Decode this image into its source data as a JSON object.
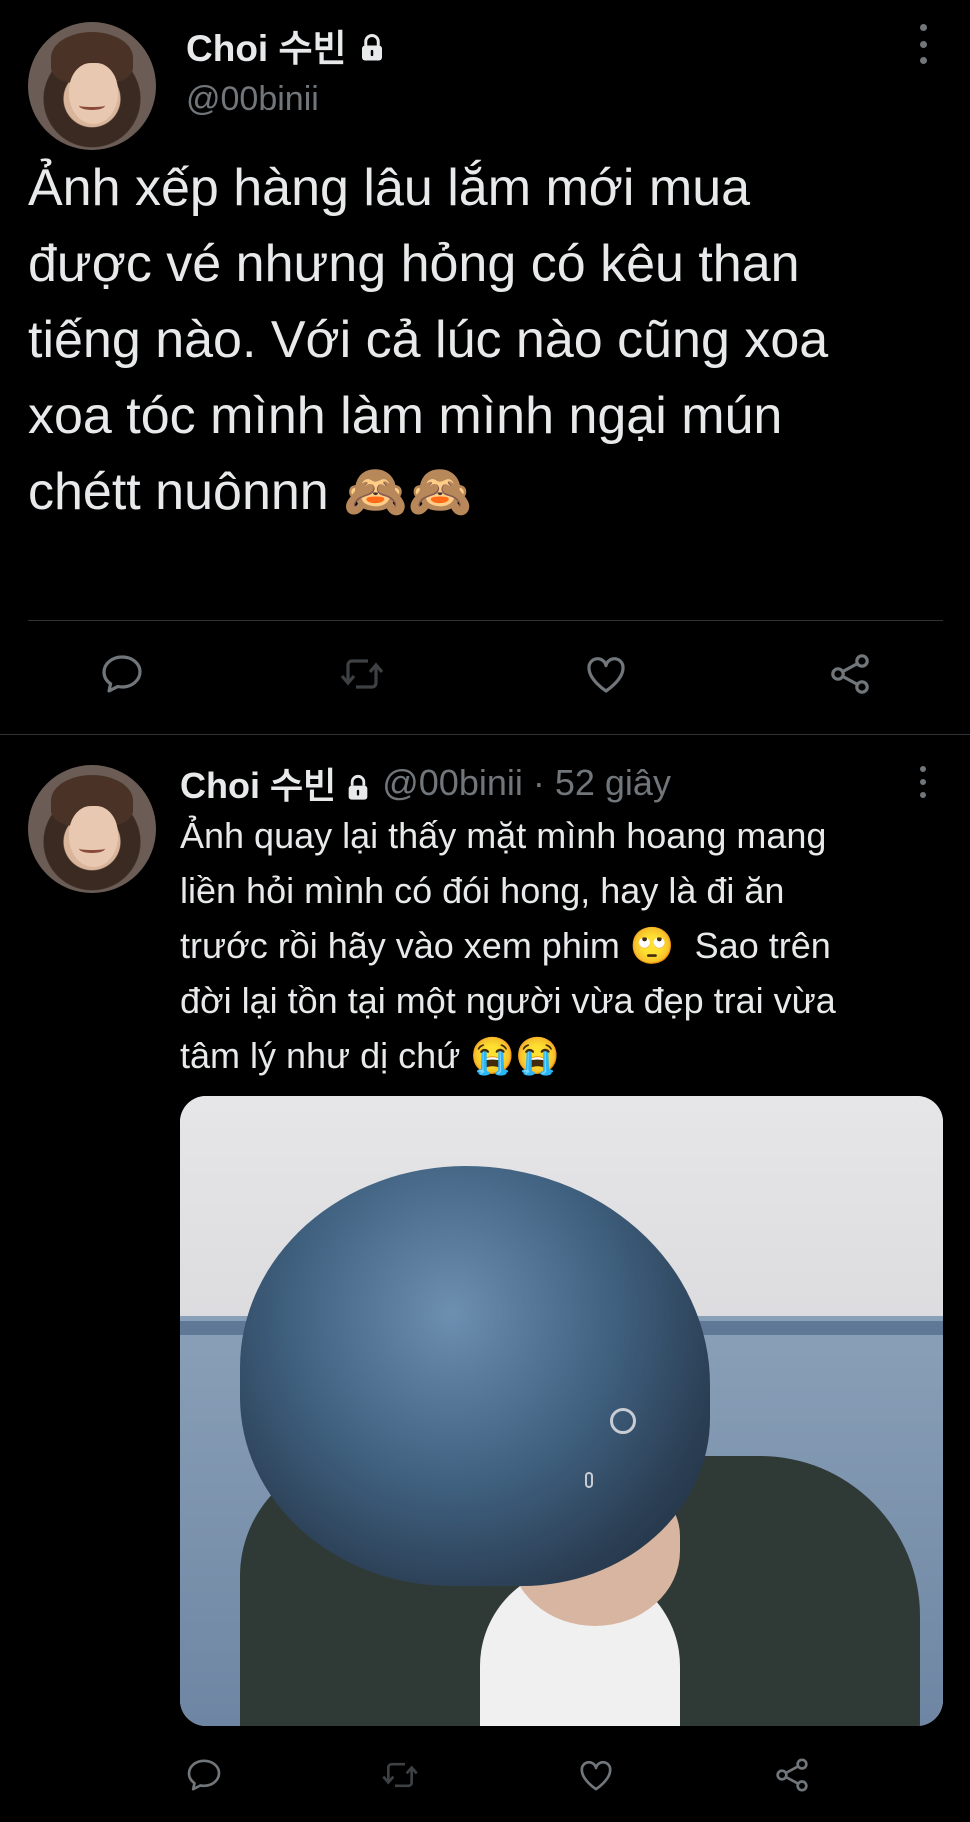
{
  "tweet1": {
    "display_name": "Choi 수빈",
    "handle": "@00binii",
    "text": "Ảnh xếp hàng lâu lắm mới mua\nđược vé nhưng hỏng có kêu than\ntiếng nào. Với cả lúc nào cũng xoa\nxoa tóc mình làm mình ngại mún\nchétt nuônnn 🙈🙈",
    "actions": [
      "reply-icon",
      "retweet-icon",
      "like-icon",
      "share-icon"
    ]
  },
  "tweet2": {
    "display_name": "Choi 수빈",
    "handle": "@00binii",
    "separator": "·",
    "time": "52 giây",
    "text": "Ảnh quay lại thấy mặt mình hoang mang\nliền hỏi mình có đói hong, hay là đi ăn\ntrước rồi hãy vào xem phim 🙄  Sao trên\nđời lại tồn tại một người vừa đẹp trai vừa\ntâm lý như dị chứ 😭😭",
    "actions": [
      "reply-icon",
      "retweet-icon",
      "like-icon",
      "share-icon"
    ]
  },
  "colors": {
    "background": "#000000",
    "text_primary": "#e7e9ea",
    "text_secondary": "#71767b",
    "divider": "#2f3336"
  }
}
